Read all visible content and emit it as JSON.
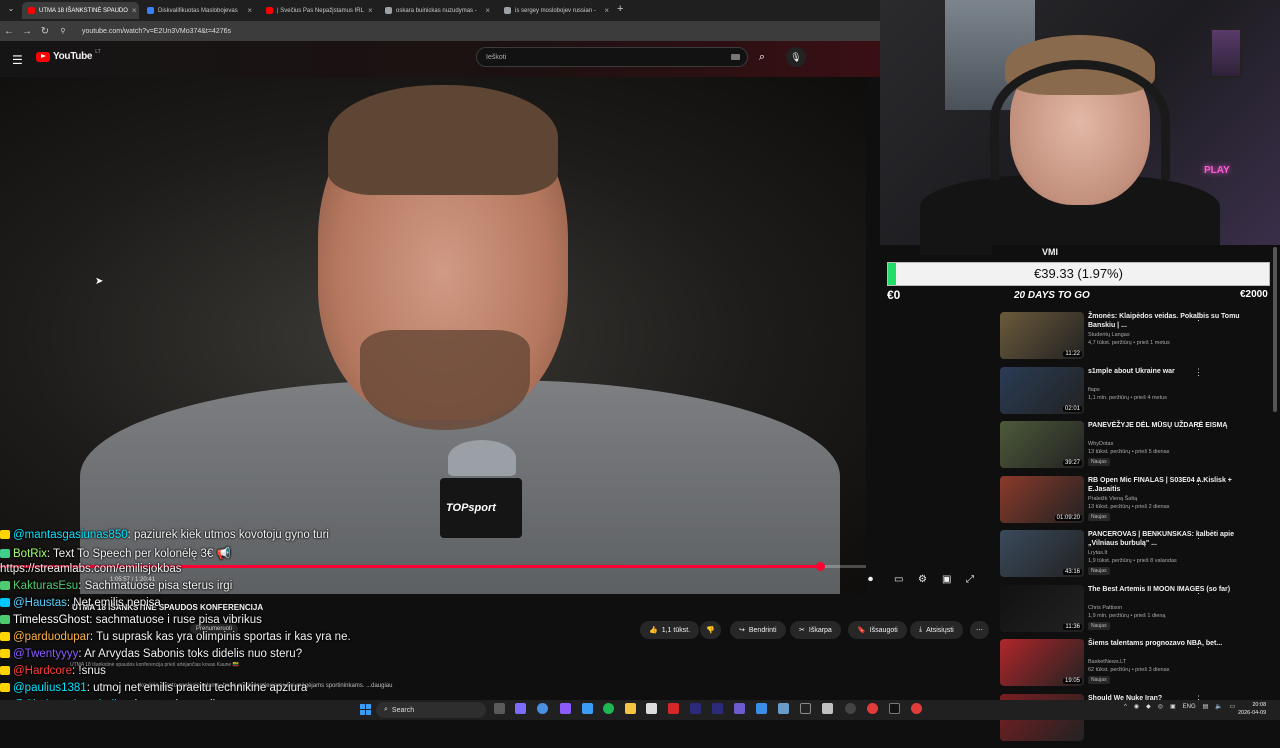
{
  "browser": {
    "tabs": [
      {
        "label": "UTMA 18 IŠANKSTINĖ SPAUDO",
        "color": "#ff0000",
        "active": true
      },
      {
        "label": "Diskvalifikuotas Maslobojevas",
        "color": "#3b82f6",
        "active": false
      },
      {
        "label": "| Svečius Pas Nepažįstamus IRL",
        "color": "#ff0000",
        "active": false
      },
      {
        "label": "oskara buinickas nuzudymas -",
        "color": "#9aa0a6",
        "active": false
      },
      {
        "label": "is sergey moslobojev russian -",
        "color": "#9aa0a6",
        "active": false
      }
    ],
    "new_tab": "+",
    "url": "youtube.com/watch?v=E2Un3VMo374&t=4276s"
  },
  "youtube": {
    "logo": "YouTube",
    "region": "LT",
    "search_placeholder": "Ieškoti",
    "video": {
      "logo_on_mic": "TOPsport",
      "time": "1:05:57 / 1:20:41",
      "progress": 0.947,
      "title": "UTMA 18 IŠANKSTINĖ SPAUDOS KONFERENCIJA",
      "channel_short": "UTMA",
      "subscribe": "Prenumeruoti",
      "likes": "1,1 tūkst.",
      "share": "Bendrinti",
      "clip": "Iškarpa",
      "save": "Išsaugoti",
      "download": "Atsisiųsti",
      "description": "UTMA 18 išankstinė spaudos konferencija prieš artėjančias kovas Kaune 🇱🇹",
      "description2": "kovinio sporto profesionalams, bet ir pradedantiesiems bei mėgėjams sportininkams. ...daugiau"
    }
  },
  "chat": [
    {
      "user": "@mantasgasiunas850",
      "msg": ": paziurek kiek utmos kovotoju gyno turi",
      "color": "#00e5ff",
      "badge": "#ffd400"
    },
    {
      "user": "BotRix",
      "msg": ": Text To Speech per kolonėlę 3€ 📢",
      "color": "#a3ff6e",
      "badge": "#3ecf8e"
    },
    {
      "user": "",
      "msg": "https://streamlabs.com/emilisjokbas",
      "color": "#ffffff",
      "badge": ""
    },
    {
      "user": "KakturasEsu",
      "msg": ": Sachmatuose pisa sterus irgi",
      "color": "#4ecb71",
      "badge": "#4ecb71"
    },
    {
      "user": "@Haustas",
      "msg": ": Net emilis nepisa",
      "color": "#5ad1ff",
      "badge": "#00c8ff"
    },
    {
      "user": "TimelessGhost",
      "msg": ": sachmatuose i ruse pisa vibrikus",
      "color": "#ffffff",
      "badge": "#4ecb71"
    },
    {
      "user": "@parduodupar",
      "msg": ": Tu suprask kas yra olimpinis sportas ir kas yra ne.",
      "color": "#ffb347",
      "badge": "#ffd400"
    },
    {
      "user": "@Twentyyyy",
      "msg": ": Ar Arvydas Sabonis toks didelis nuo steru?",
      "color": "#8a5cff",
      "badge": "#ffd400"
    },
    {
      "user": "@Hardcore",
      "msg": ": !snus",
      "color": "#ff3b3b",
      "badge": "#ffd400"
    },
    {
      "user": "@paulius1381",
      "msg": ": utmoj net emilis praeitu technikine apziura",
      "color": "#00e5ff",
      "badge": "#ffd400"
    },
    {
      "user": "@Chokeontheseballs",
      "msg": ": visur yra korupcijos",
      "color": "#00e5ff",
      "badge": "#ffd400"
    }
  ],
  "goal": {
    "current": "€39.33 (1.97%)",
    "min": "€0",
    "max": "€2000",
    "fraction": 0.0197,
    "fill_color": "#22dd66",
    "overlay": "20 DAYS TO GO"
  },
  "webcam": {
    "neon": "PLAY"
  },
  "sidebar": {
    "items": [
      {
        "title": "Žmonės: Klaipėdos veidas. Pokalbis su Tomu Banskiu | ...",
        "channel": "Studentų Langas",
        "meta": "4,7 tūkst. peržiūrų • prieš 1 metus",
        "duration": "11:22",
        "new": "",
        "thumb": "#6b5a3c"
      },
      {
        "title": "s1mple about Ukraine war",
        "channel": "flaps",
        "meta": "1,1 mln. peržiūrų • prieš 4 metus",
        "duration": "02:01",
        "new": "",
        "thumb": "#2a3c55"
      },
      {
        "title": "PANEVĖŽYJE DĖL MŪSŲ UŽDARĖ EISMĄ",
        "channel": "WhyDotas",
        "meta": "13 tūkst. peržiūrų • prieš 5 dienas",
        "duration": "39:27",
        "new": "Naujas",
        "thumb": "#4d5a3a"
      },
      {
        "title": "RB Open Mic FINALAS | S03E04 A.Kislisk + E.Jasaitis",
        "channel": "Praleižk Vieną Šaltą",
        "meta": "13 tūkst. peržiūrų • prieš 2 dienas",
        "duration": "01:09:20",
        "new": "Naujas",
        "thumb": "#8a3a2a"
      },
      {
        "title": "PANCEROVAS | BENKUNSKAS: kalbėti apie „Vilniaus burbulą\" ...",
        "channel": "Lrytas.lt",
        "meta": "1,9 tūkst. peržiūrų • prieš 8 valandas",
        "duration": "43:16",
        "new": "Naujas",
        "thumb": "#3a4a5c"
      },
      {
        "title": "The Best Artemis II MOON IMAGES (so far)",
        "channel": "Chris Pattison",
        "meta": "1,9 mln. peržiūrų • prieš 1 dieną",
        "duration": "11:36",
        "new": "Naujas",
        "thumb": "#111111"
      },
      {
        "title": "Šiems talentams prognozavo NBA, bet...",
        "channel": "BasketNews.LT",
        "meta": "62 tūkst. peržiūrų • prieš 3 dienas",
        "duration": "19:05",
        "new": "Naujas",
        "thumb": "#b0262a"
      },
      {
        "title": "Should We Nuke Iran?",
        "channel": "",
        "meta": "",
        "duration": "",
        "new": "",
        "thumb": "#7a1e22"
      }
    ],
    "top_partial": "VMI"
  },
  "taskbar": {
    "search": "Search",
    "lang": "ENG",
    "time": "20:08",
    "date": "2026-04-09"
  }
}
